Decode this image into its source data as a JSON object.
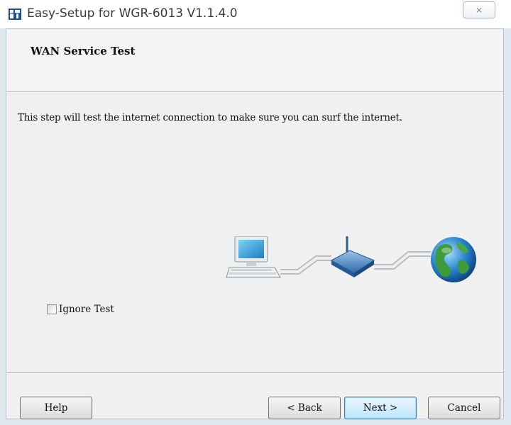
{
  "window": {
    "title": "Easy-Setup for WGR-6013  V1.1.4.0",
    "close_glyph": "⨯"
  },
  "header": {
    "title": "WAN Service Test"
  },
  "body": {
    "description": "This step will test the internet connection to make sure you can surf the internet.",
    "illustration_icons": [
      "computer-icon",
      "router-icon",
      "globe-icon"
    ],
    "ignore_test": {
      "label": "Ignore Test",
      "checked": false
    }
  },
  "buttons": {
    "help": "Help",
    "back": "< Back",
    "next": "Next >",
    "cancel": "Cancel"
  },
  "colors": {
    "default_button_border": "#3c7fb1",
    "window_frame": "#dfe7ef"
  }
}
